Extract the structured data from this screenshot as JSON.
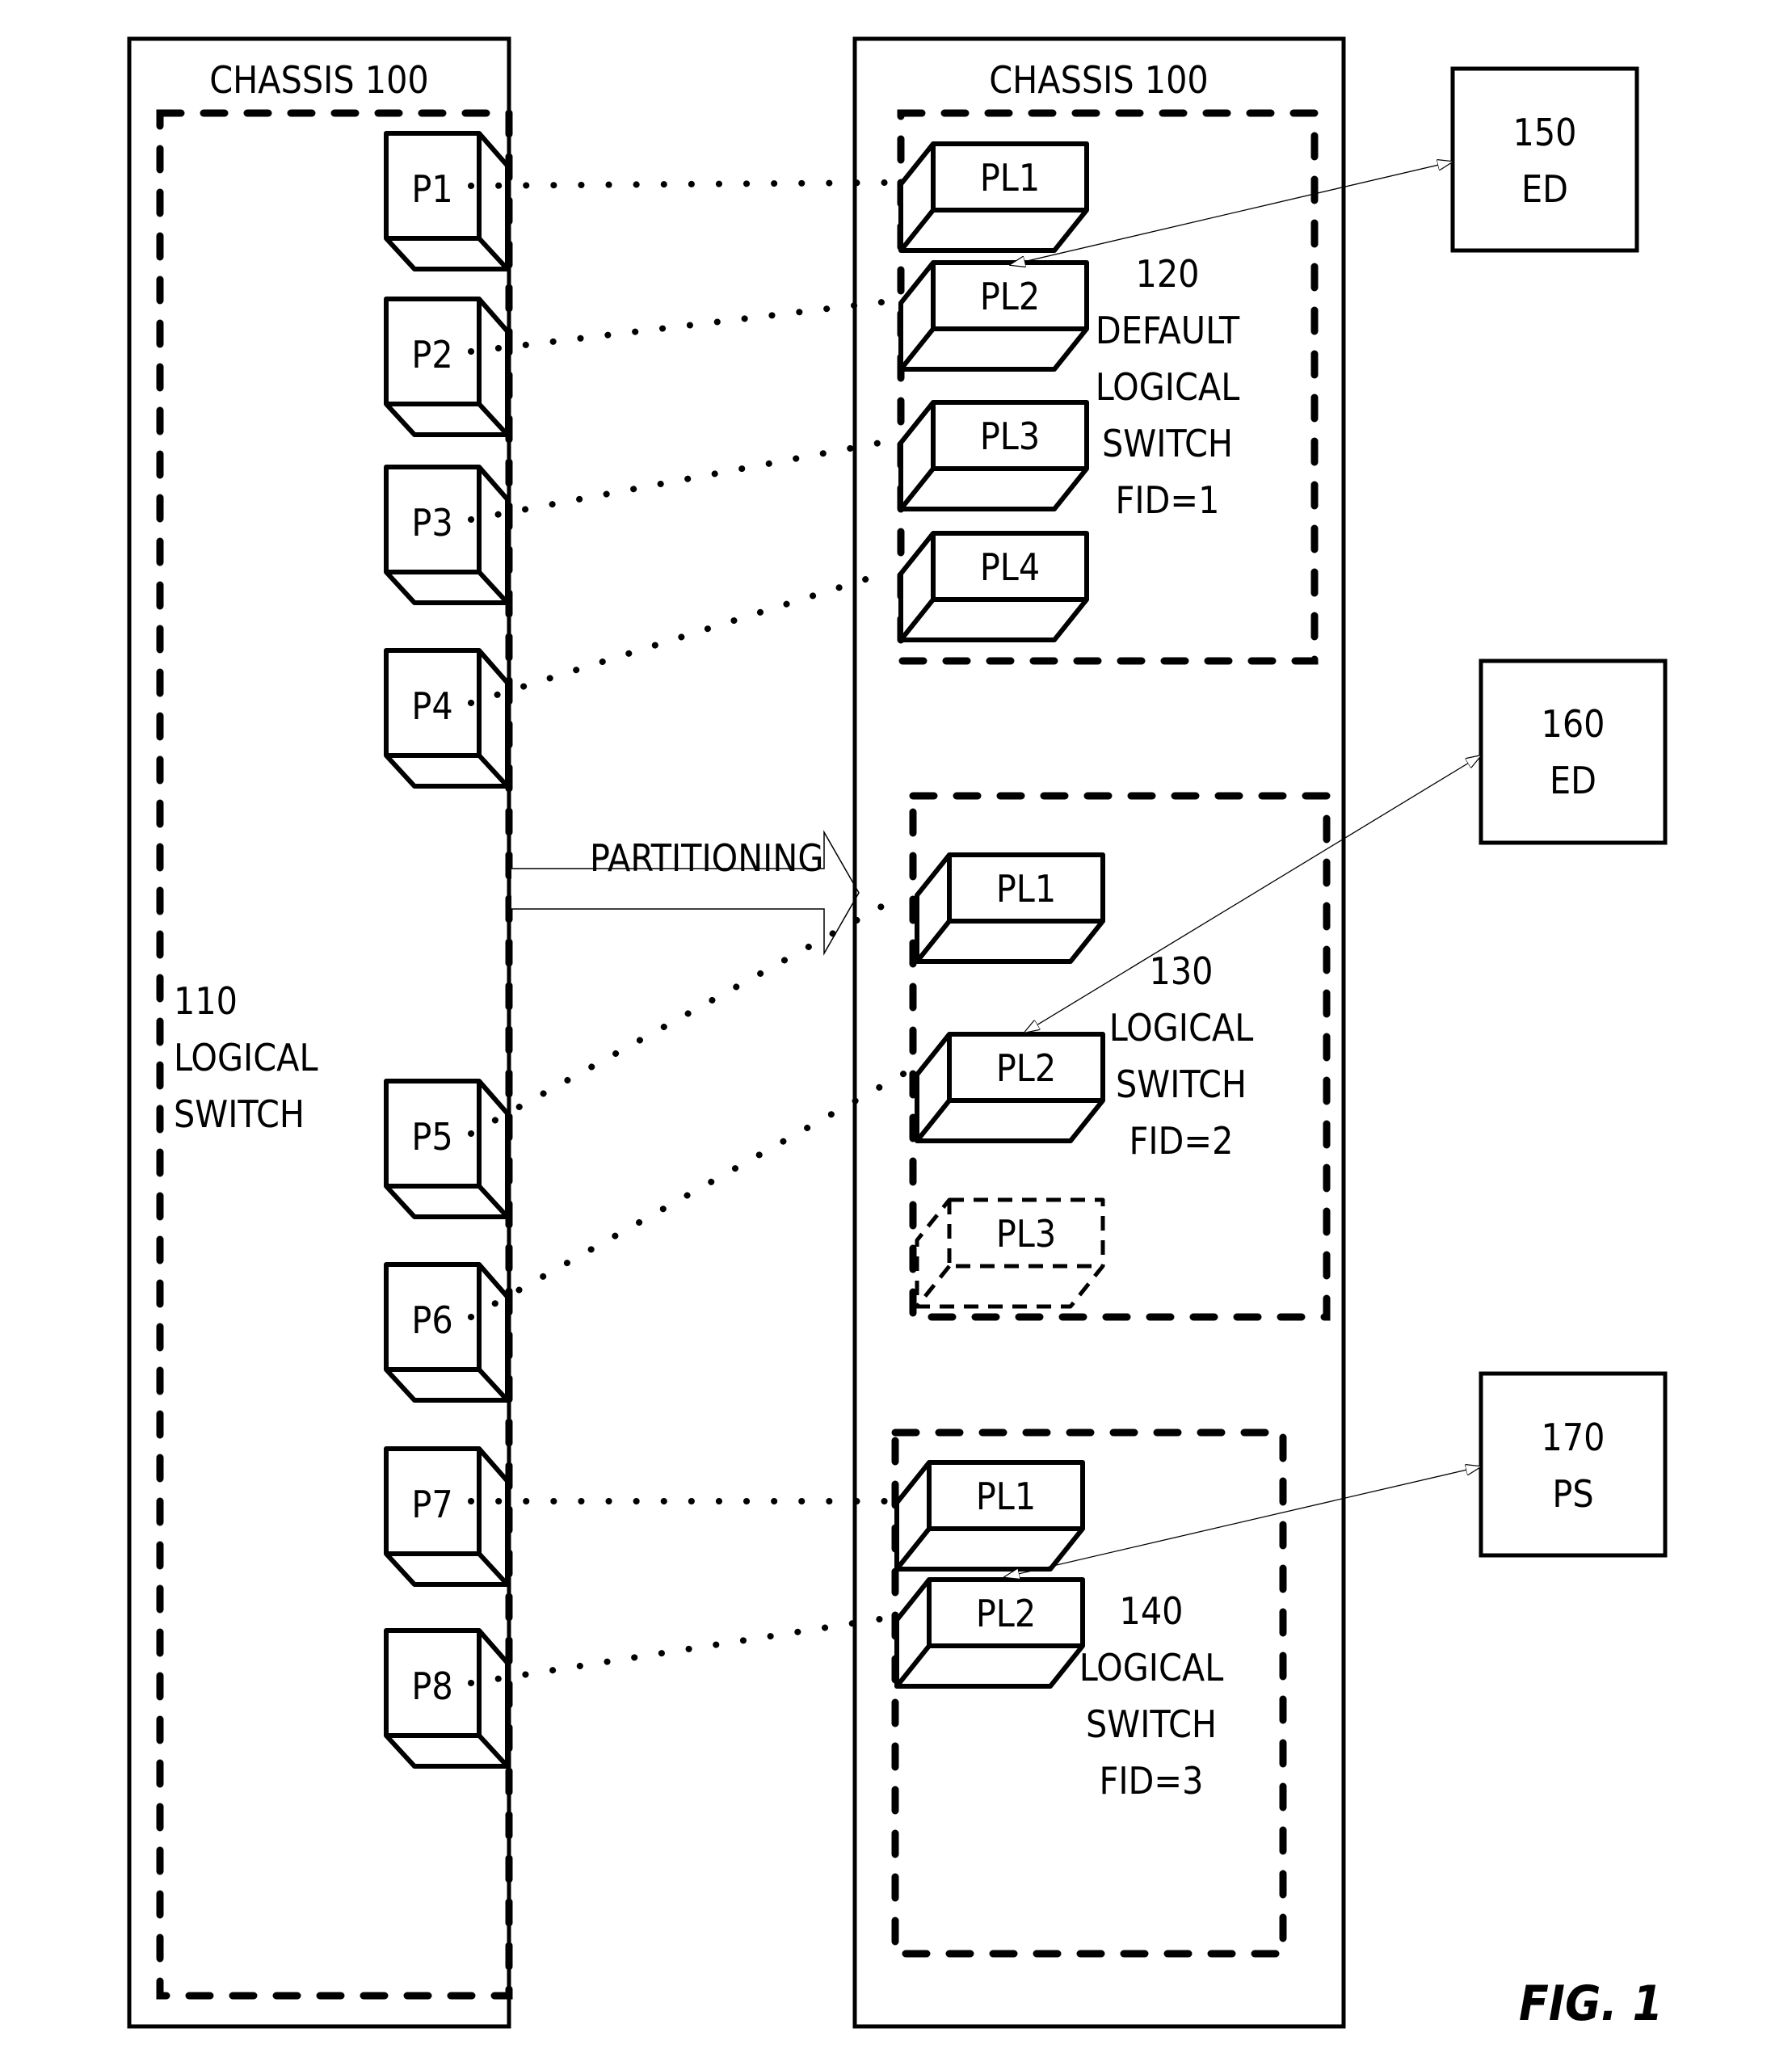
{
  "figure_label": "FIG. 1",
  "left_chassis": {
    "title": "CHASSIS 100",
    "switch_label": [
      "110",
      "LOGICAL",
      "SWITCH"
    ],
    "ports": [
      "P1",
      "P2",
      "P3",
      "P4",
      "P5",
      "P6",
      "P7",
      "P8"
    ]
  },
  "partition_arrow": {
    "label": "PARTITIONING"
  },
  "right_chassis": {
    "title": "CHASSIS 100",
    "switches": [
      {
        "label": [
          "120",
          "DEFAULT",
          "LOGICAL",
          "SWITCH",
          "FID=1"
        ],
        "ports": [
          "PL1",
          "PL2",
          "PL3",
          "PL4"
        ]
      },
      {
        "label": [
          "130",
          "LOGICAL",
          "SWITCH",
          "FID=2"
        ],
        "ports": [
          "PL1",
          "PL2",
          "PL3"
        ],
        "dashed_port": "PL3"
      },
      {
        "label": [
          "140",
          "LOGICAL",
          "SWITCH",
          "FID=3"
        ],
        "ports": [
          "PL1",
          "PL2"
        ]
      }
    ]
  },
  "devices": [
    {
      "id": "150",
      "type": "ED"
    },
    {
      "id": "160",
      "type": "ED"
    },
    {
      "id": "170",
      "type": "PS"
    }
  ]
}
